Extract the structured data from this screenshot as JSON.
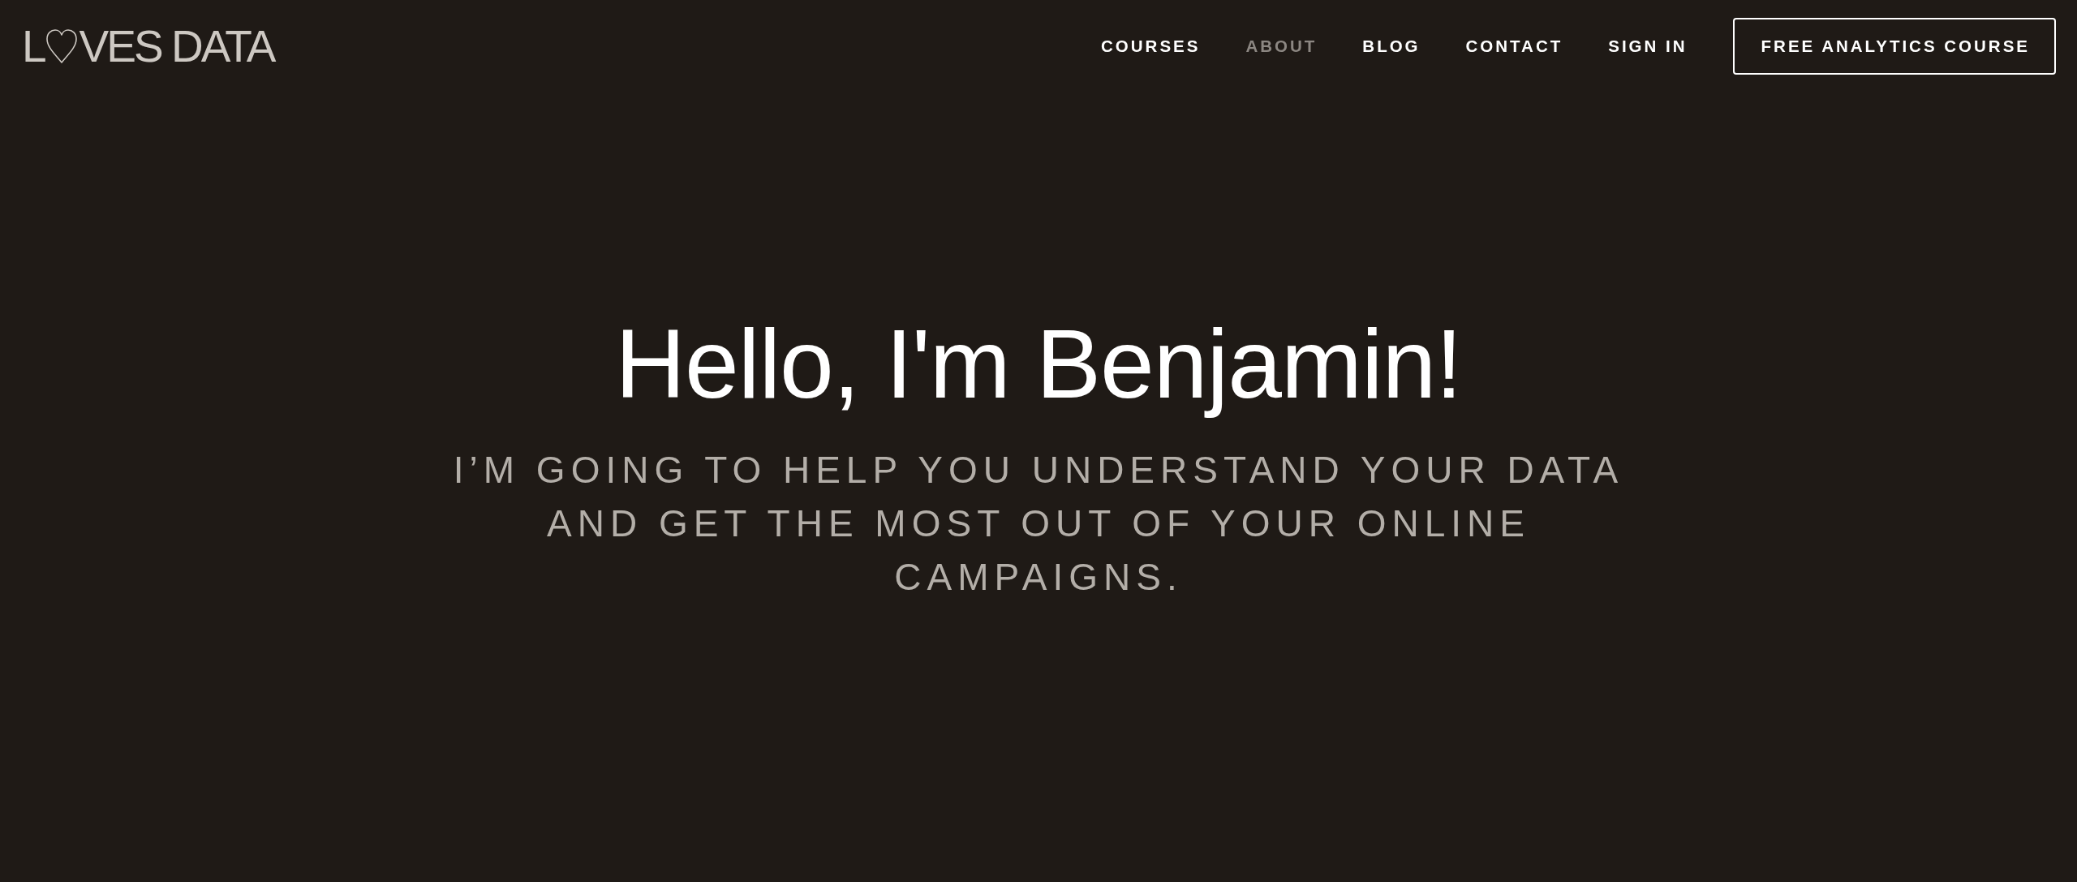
{
  "logo": {
    "text_before": "L",
    "text_after": "VES DATA"
  },
  "nav": {
    "items": [
      {
        "label": "COURSES",
        "selected": false
      },
      {
        "label": "ABOUT",
        "selected": true
      },
      {
        "label": "BLOG",
        "selected": false
      },
      {
        "label": "CONTACT",
        "selected": false
      },
      {
        "label": "SIGN IN",
        "selected": false
      }
    ],
    "cta": {
      "label": "FREE ANALYTICS COURSE"
    }
  },
  "hero": {
    "title": "Hello, I'm Benjamin!",
    "subtitle": "I’M GOING TO HELP YOU UNDERSTAND YOUR DATA AND GET THE MOST OUT OF YOUR ONLINE CAMPAIGNS."
  }
}
